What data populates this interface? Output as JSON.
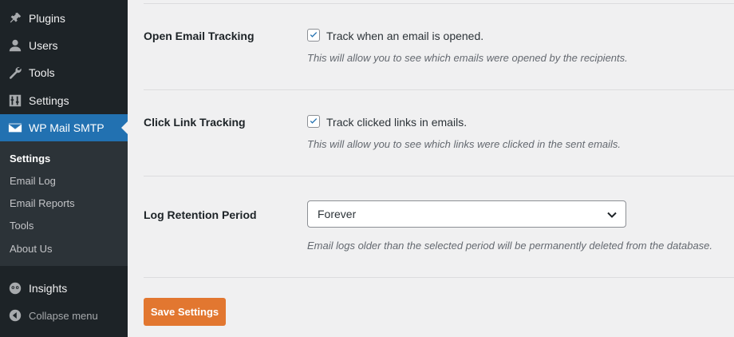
{
  "sidebar": {
    "menu": [
      {
        "label": "Plugins",
        "icon": "plugin-icon"
      },
      {
        "label": "Users",
        "icon": "user-icon"
      },
      {
        "label": "Tools",
        "icon": "wrench-icon"
      },
      {
        "label": "Settings",
        "icon": "settings-icon"
      },
      {
        "label": "WP Mail SMTP",
        "icon": "mail-icon"
      }
    ],
    "submenu": [
      "Settings",
      "Email Log",
      "Email Reports",
      "Tools",
      "About Us"
    ],
    "insights": {
      "label": "Insights",
      "icon": "insights-icon"
    },
    "collapse": {
      "label": "Collapse menu",
      "icon": "collapse-icon"
    }
  },
  "settings": {
    "open_tracking": {
      "label": "Open Email Tracking",
      "checkbox_label": "Track when an email is opened.",
      "checked": true,
      "description": "This will allow you to see which emails were opened by the recipients."
    },
    "click_tracking": {
      "label": "Click Link Tracking",
      "checkbox_label": "Track clicked links in emails.",
      "checked": true,
      "description": "This will allow you to see which links were clicked in the sent emails."
    },
    "retention": {
      "label": "Log Retention Period",
      "selected": "Forever",
      "description": "Email logs older than the selected period will be permanently deleted from the database."
    },
    "save_label": "Save Settings"
  },
  "colors": {
    "sidebar_bg": "#1d2327",
    "submenu_bg": "#2c3338",
    "active_bg": "#2271b1",
    "save_button": "#e27730"
  }
}
